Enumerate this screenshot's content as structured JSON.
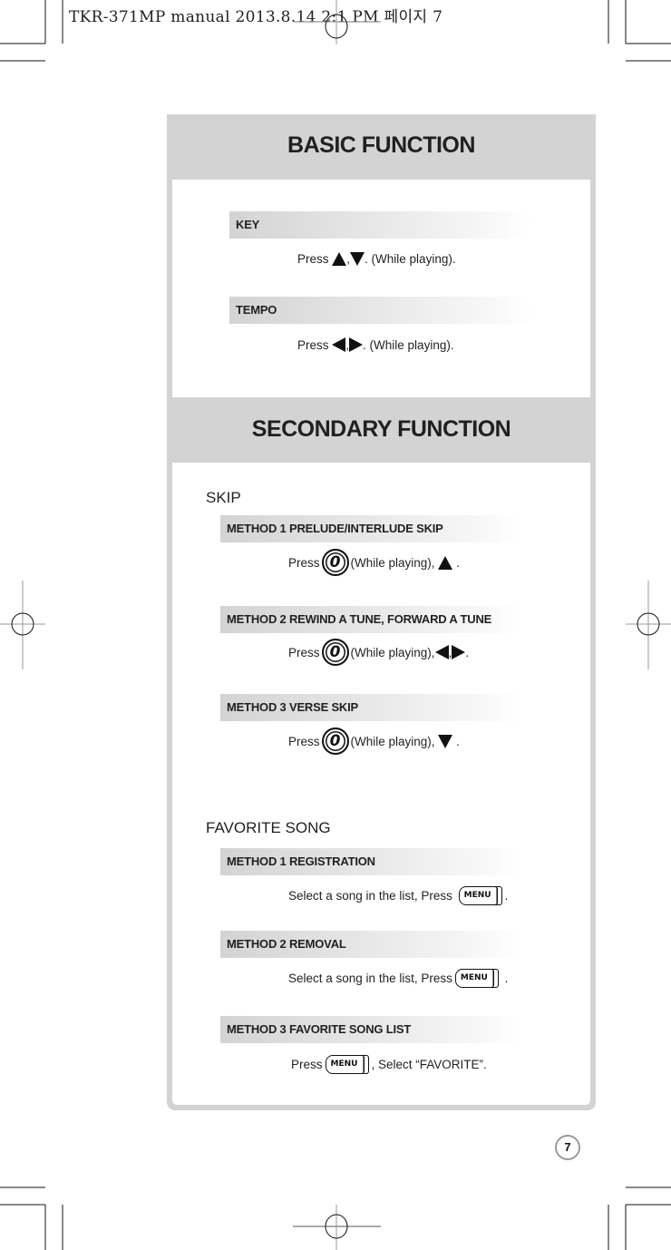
{
  "print_header": "TKR-371MP manual  2013.8.14  2:1 PM 페이지 7",
  "basic": {
    "title": "BASIC FUNCTION",
    "sections": [
      {
        "label": "KEY",
        "instruction": {
          "pre": "Press",
          "icons": [
            "up-triangle",
            "down-triangle"
          ],
          "sep": ",",
          "post": ". (While playing)."
        }
      },
      {
        "label": "TEMPO",
        "instruction": {
          "pre": "Press",
          "icons": [
            "left-triangle",
            "right-triangle"
          ],
          "sep": ",",
          "post": ". (While playing)."
        }
      }
    ]
  },
  "secondary": {
    "title": "SECONDARY FUNCTION",
    "groups": [
      {
        "label": "SKIP",
        "methods": [
          {
            "label": "METHOD 1  PRELUDE/INTERLUDE SKIP",
            "pre": "Press",
            "button": "0",
            "mid": "(While playing),",
            "post": "."
          },
          {
            "label": "METHOD 2  REWIND A TUNE, FORWARD A TUNE",
            "pre": "Press",
            "button": "0",
            "mid": "(While playing),",
            "sep": ",",
            "post": "."
          },
          {
            "label": "METHOD 3  VERSE SKIP",
            "pre": "Press",
            "button": "0",
            "mid": "(While playing),",
            "post": "."
          }
        ]
      },
      {
        "label": "FAVORITE SONG",
        "methods": [
          {
            "label": "METHOD 1  REGISTRATION",
            "pre": "Select a song in the list, Press",
            "button": "MENU",
            "post": "."
          },
          {
            "label": "METHOD 2  REMOVAL",
            "pre": "Select a song in the list, Press",
            "button": "MENU",
            "post": "."
          },
          {
            "label": "METHOD 3  FAVORITE SONG LIST",
            "pre": "Press",
            "button": "MENU",
            "post": ", Select “FAVORITE”."
          }
        ]
      }
    ]
  },
  "page_number": "7"
}
